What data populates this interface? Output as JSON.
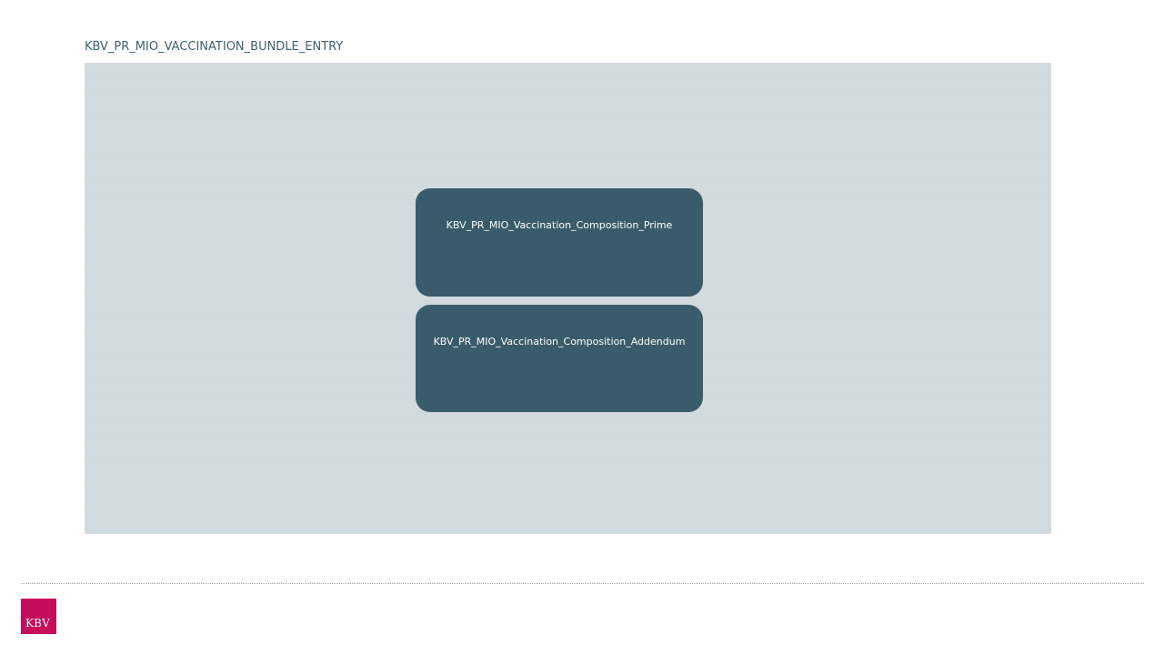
{
  "diagram": {
    "title": "KBV_PR_MIO_VACCINATION_BUNDLE_ENTRY",
    "nodes": [
      {
        "label": "KBV_PR_MIO_Vaccination_Composition_Prime"
      },
      {
        "label": "KBV_PR_MIO_Vaccination_Composition_Addendum"
      }
    ]
  },
  "footer": {
    "logo_text": "KBV"
  },
  "colors": {
    "panel": "#cfd8dc",
    "node": "#3a5b6b",
    "title_text": "#3f5f6f",
    "logo": "#c50c5a"
  }
}
